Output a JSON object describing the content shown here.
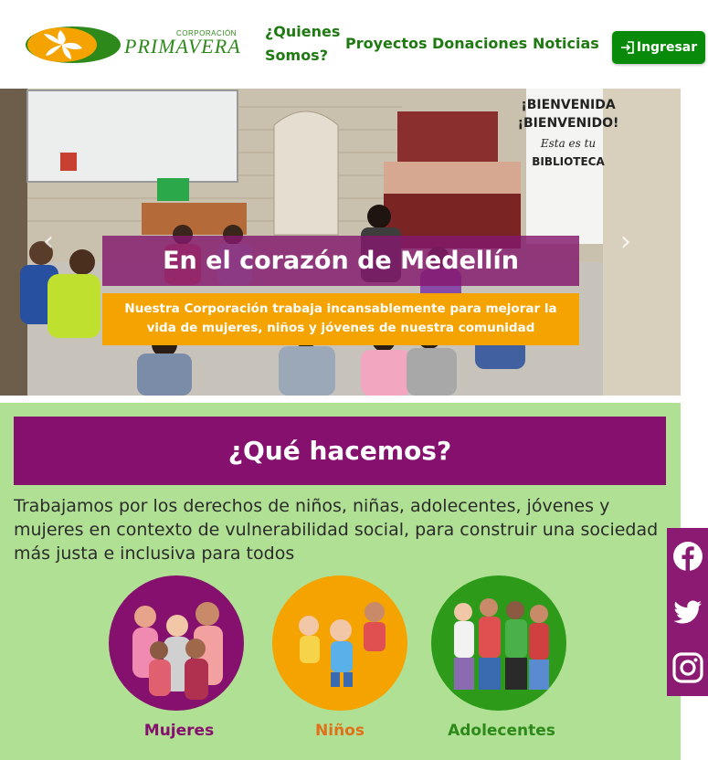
{
  "header": {
    "logo_small": "CORPORACIÓN",
    "logo_big": "PRIMAVERA",
    "nav": [
      {
        "label_line1": "¿Quienes",
        "label_line2": "Somos?"
      },
      {
        "label": "Proyectos"
      },
      {
        "label": "Donaciones"
      },
      {
        "label": "Noticias"
      }
    ],
    "login_label": "Ingresar"
  },
  "hero": {
    "title": "En el corazón de Medellín",
    "subtitle": "Nuestra Corporación trabaja incansablemente para mejorar la vida de mujeres, niños y jóvenes de nuestra comunidad",
    "sign_line1": "¡BIENVENIDA",
    "sign_line2": "¡BIENVENIDO!",
    "sign_line3": "Esta es tu",
    "sign_line4": "BIBLIOTECA"
  },
  "section": {
    "title": "¿Qué hacemos?",
    "text": "Trabajamos por los derechos de niños, niñas, adolecentes, jóvenes y mujeres en contexto de vulnerabilidad social, para construir una sociedad más justa e inclusiva para todos",
    "cards": [
      {
        "label": "Mujeres",
        "color": "#86106e"
      },
      {
        "label": "Niños",
        "color": "#e07a10"
      },
      {
        "label": "Adolecentes",
        "color": "#2d8a1a"
      }
    ]
  },
  "social": [
    "facebook-icon",
    "twitter-icon",
    "instagram-icon"
  ],
  "colors": {
    "brand_green": "#1f7a12",
    "brand_purple": "#86106e",
    "accent_orange": "#f4a300",
    "section_bg": "#b0e093"
  }
}
